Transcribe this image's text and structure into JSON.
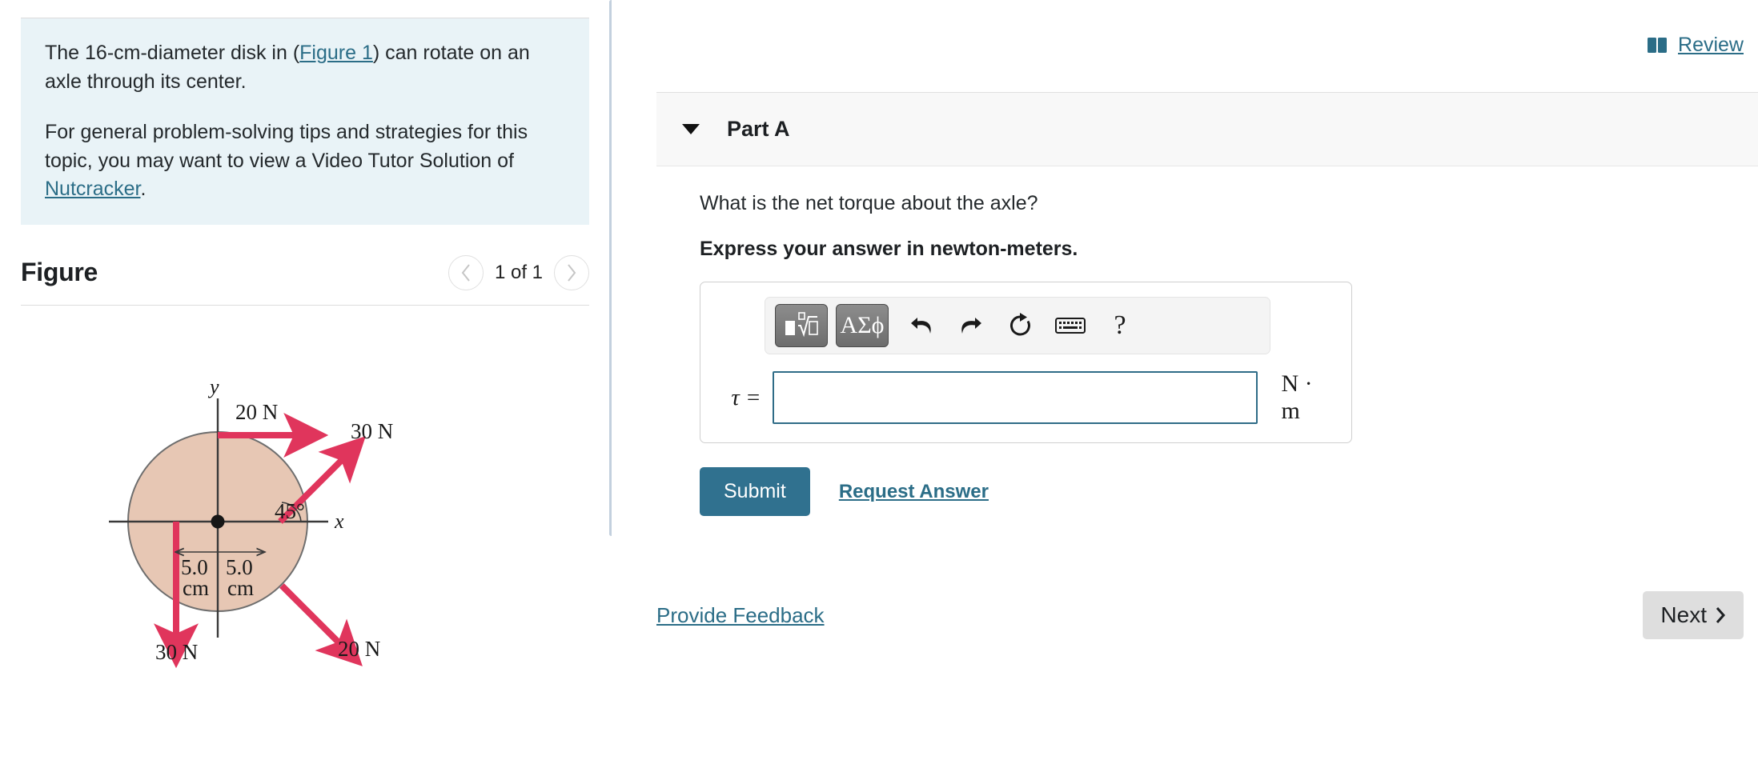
{
  "problem": {
    "paragraph1_pre": "The 16-cm-diameter disk in (",
    "paragraph1_link": "Figure 1",
    "paragraph1_post": ") can rotate on an axle through its center.",
    "paragraph2_pre": "For general problem-solving tips and strategies for this topic, you may want to view a Video Tutor Solution of ",
    "paragraph2_link": "Nutcracker",
    "paragraph2_post": "."
  },
  "figure": {
    "title": "Figure",
    "counter": "1 of 1",
    "prev_icon": "chevron-left-icon",
    "next_icon": "chevron-right-icon",
    "diagram": {
      "axis_x_label": "x",
      "axis_y_label": "y",
      "angle_label": "45°",
      "dim_left_value": "5.0",
      "dim_left_unit": "cm",
      "dim_right_value": "5.0",
      "dim_right_unit": "cm",
      "disk_fill": "#e7c7b4",
      "disk_stroke": "#6e6e6e",
      "arrow_color": "#e0355c",
      "forces": [
        {
          "label": "20 N",
          "direction": "right",
          "position": "top-edge"
        },
        {
          "label": "30 N",
          "direction": "up-right-45",
          "position": "right-edge"
        },
        {
          "label": "20 N",
          "direction": "down-right-45",
          "position": "lower-right-edge"
        },
        {
          "label": "30 N",
          "direction": "down",
          "position": "left-of-center"
        }
      ]
    }
  },
  "review": {
    "label": "Review",
    "icon": "book-icon"
  },
  "part": {
    "title": "Part A",
    "caret_icon": "caret-down-icon",
    "question": "What is the net torque about the axle?",
    "instruction": "Express your answer in newton-meters."
  },
  "answer": {
    "variable_label": "τ =",
    "value": "",
    "unit": "N · m",
    "toolbar": [
      {
        "name": "math-template-button",
        "glyph": "nth-root-icon",
        "type": "button"
      },
      {
        "name": "greek-symbols-button",
        "glyph": "ΑΣϕ",
        "type": "button"
      },
      {
        "name": "undo-button",
        "glyph": "undo-icon",
        "type": "icon"
      },
      {
        "name": "redo-button",
        "glyph": "redo-icon",
        "type": "icon"
      },
      {
        "name": "reset-button",
        "glyph": "reset-icon",
        "type": "icon"
      },
      {
        "name": "keyboard-button",
        "glyph": "keyboard-icon",
        "type": "icon"
      },
      {
        "name": "help-button",
        "glyph": "?",
        "type": "icon"
      }
    ]
  },
  "actions": {
    "submit_label": "Submit",
    "request_answer_label": "Request Answer"
  },
  "footer": {
    "feedback_label": "Provide Feedback",
    "next_label": "Next",
    "next_icon": "chevron-right-icon"
  },
  "colors": {
    "accent": "#2b6d87",
    "submit": "#30718f",
    "statement_bg": "#e9f3f7",
    "part_header_bg": "#f8f8f8",
    "arrow": "#e0355c",
    "disk": "#e7c7b4"
  }
}
